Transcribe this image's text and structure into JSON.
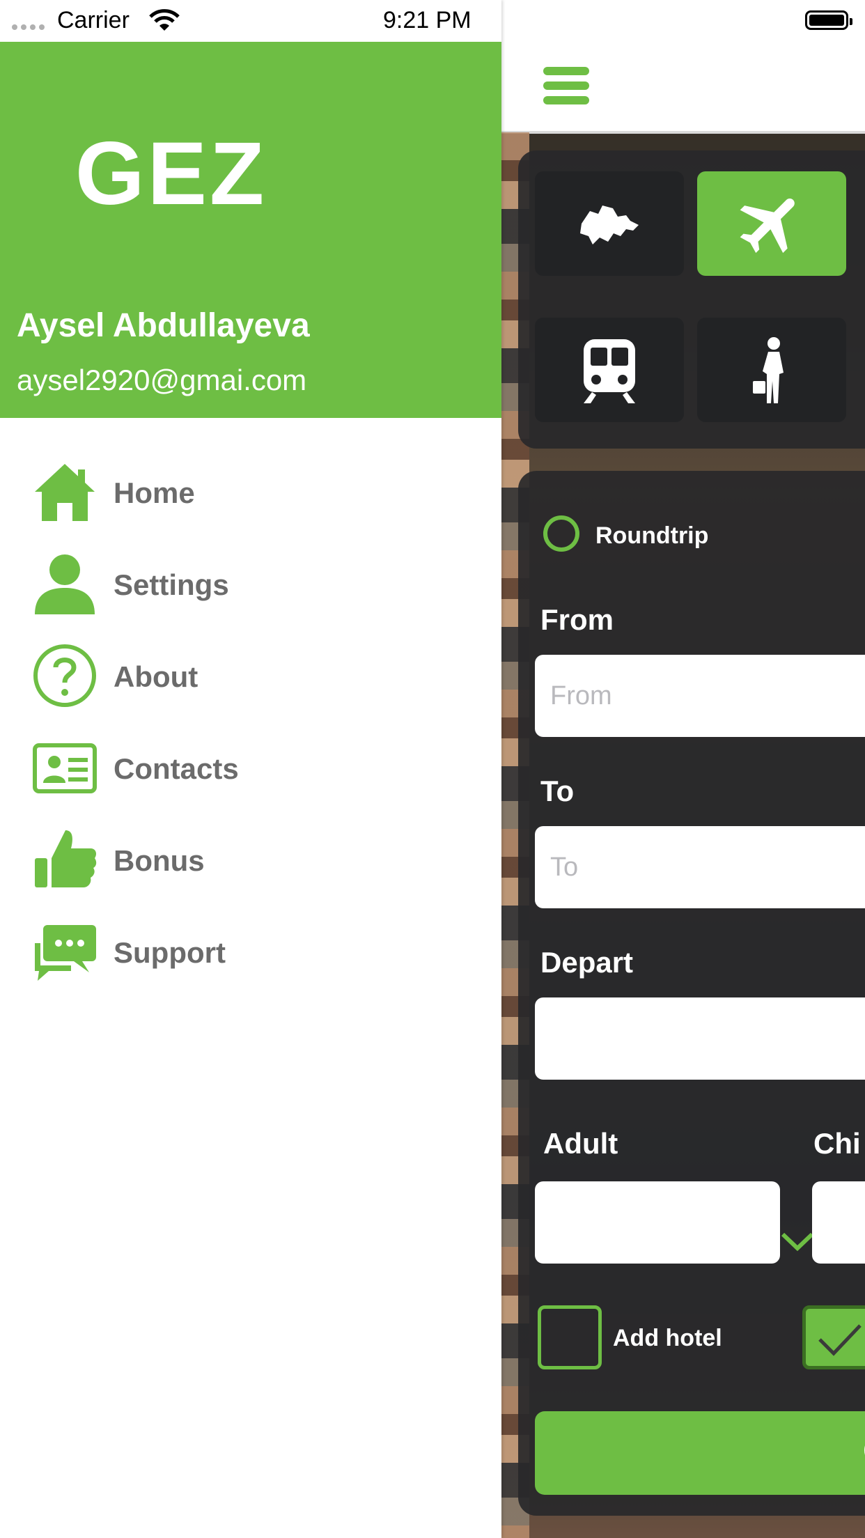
{
  "status_bar": {
    "carrier": "Carrier",
    "time": "9:21 PM"
  },
  "drawer": {
    "logo_text": "GEZ",
    "user": {
      "name": "Aysel Abdullayeva",
      "email": "aysel2920@gmai.com"
    },
    "menu": [
      {
        "label": "Home",
        "icon": "home-icon"
      },
      {
        "label": "Settings",
        "icon": "user-icon"
      },
      {
        "label": "About",
        "icon": "question-icon"
      },
      {
        "label": "Contacts",
        "icon": "contact-card-icon"
      },
      {
        "label": "Bonus",
        "icon": "thumbs-up-icon"
      },
      {
        "label": "Support",
        "icon": "chat-icon"
      }
    ]
  },
  "main": {
    "categories": [
      {
        "name": "local-tours",
        "icon": "azerbaijan-map-icon",
        "active": false
      },
      {
        "name": "flights",
        "icon": "airplane-icon",
        "active": true
      },
      {
        "name": "trains",
        "icon": "train-icon",
        "active": false
      },
      {
        "name": "traveler",
        "icon": "traveler-icon",
        "active": false
      }
    ],
    "trip_type": {
      "label": "Roundtrip"
    },
    "from": {
      "label": "From",
      "placeholder": "From",
      "value": ""
    },
    "to": {
      "label": "To",
      "placeholder": "To",
      "value": ""
    },
    "depart": {
      "label": "Depart",
      "value": ""
    },
    "adult": {
      "label": "Adult",
      "value": ""
    },
    "child": {
      "label": "Chi"
    },
    "add_hotel": {
      "label": "Add hotel",
      "checked": false
    },
    "second_checkbox": {
      "checked": true
    }
  },
  "colors": {
    "accent": "#6ebe44",
    "menu_text": "#6b6b6b",
    "panel": "#28282a"
  }
}
